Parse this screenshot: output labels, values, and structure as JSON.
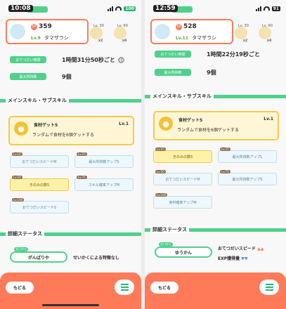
{
  "left": {
    "status_time": "10:08",
    "battery": "100",
    "mon": {
      "sp_label": "SP",
      "sp_value": "359",
      "lv_label": "Lv.9",
      "name": "タマザラシ"
    },
    "items": [
      {
        "lv": "Lv. 30"
      },
      {
        "lv": "Lv. 60"
      }
    ],
    "item_counts": [
      "x2",
      "x4"
    ],
    "help_time_label": "おてつだい時間",
    "help_time_value": "1時間31分50秒ごと",
    "max_items_label": "最大所持数",
    "max_items_value": "9個",
    "section_skills": "メインスキル・サブスキル",
    "skill": {
      "name": "食材ゲットS",
      "lv": "Lv.1",
      "desc": "ランダムで食材を6個ゲットする"
    },
    "subs": [
      {
        "lv": "Lv.10",
        "label": "おてつだいスピードM",
        "gold": false
      },
      {
        "lv": "Lv.25",
        "label": "最大所持数アップS",
        "gold": false
      },
      {
        "lv": "Lv.50",
        "label": "きのみの数S",
        "gold": true
      },
      {
        "lv": "Lv.75",
        "label": "スキル確率アップM",
        "gold": false
      },
      {
        "lv": "Lv.100",
        "label": "おてつだいスピードS",
        "gold": false
      }
    ],
    "section_status": "詳細ステータス",
    "nature_tag": "せいかく",
    "nature": "がんばりや",
    "nature_text": "せいかくによる特徴なし",
    "back": "もどる"
  },
  "right": {
    "status_time": "12:59",
    "battery": "91",
    "mon": {
      "sp_label": "SP",
      "sp_value": "528",
      "lv_label": "Lv.11",
      "name": "タマザラシ"
    },
    "items": [
      {
        "lv": "Lv. 30"
      },
      {
        "lv": "Lv. 60"
      }
    ],
    "item_counts": [
      "x2",
      "x4"
    ],
    "help_time_label": "おてつだい時間",
    "help_time_value": "1時間22分19秒ごと",
    "max_items_label": "最大所持数",
    "max_items_value": "9個",
    "section_skills": "メインスキル・サブスキル",
    "skill": {
      "name": "食材ゲットS",
      "lv": "Lv.1",
      "desc": "ランダムで食材を6個ゲットする"
    },
    "subs": [
      {
        "lv": "Lv.10",
        "label": "きのみの数S",
        "gold": true
      },
      {
        "lv": "Lv.25",
        "label": "最大所持数アップL",
        "gold": false
      },
      {
        "lv": "Lv.50",
        "label": "おてつだいスピードM",
        "gold": false
      },
      {
        "lv": "Lv.75",
        "label": "最大所持数アップS",
        "gold": false
      },
      {
        "lv": "Lv.100",
        "label": "食材確率アップM",
        "gold": false
      }
    ],
    "section_status": "詳細ステータス",
    "nature_tag": "せいかく",
    "nature": "ゆうかん",
    "nature_up": "おてつだいスピード",
    "nature_down": "EXP獲得量",
    "back": "もどる"
  },
  "colors": {
    "accent": "#ff7a59",
    "green": "#4fd18b",
    "gold": "#f4cb4a"
  },
  "icons": {
    "info": "ⓘ",
    "menu": "menu-icon"
  }
}
